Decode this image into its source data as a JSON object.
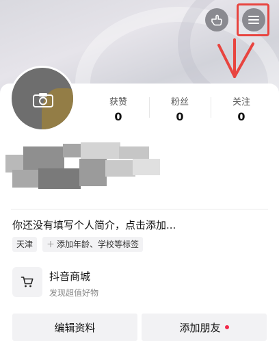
{
  "header": {
    "hand_icon": "hand-pointer-icon",
    "menu_icon": "menu-icon"
  },
  "profile": {
    "avatar_icon": "camera-icon"
  },
  "stats": [
    {
      "label": "获赞",
      "value": "0"
    },
    {
      "label": "粉丝",
      "value": "0"
    },
    {
      "label": "关注",
      "value": "0"
    }
  ],
  "bio": {
    "placeholder": "你还没有填写个人简介，点击添加..."
  },
  "tags": {
    "city": "天津",
    "add_label": "添加年龄、学校等标签"
  },
  "shop": {
    "title": "抖音商城",
    "subtitle": "发现超值好物"
  },
  "actions": {
    "edit_label": "编辑资料",
    "add_friend_label": "添加朋友"
  },
  "colors": {
    "annotation": "#e8443f",
    "notification_dot": "#f2294a"
  }
}
